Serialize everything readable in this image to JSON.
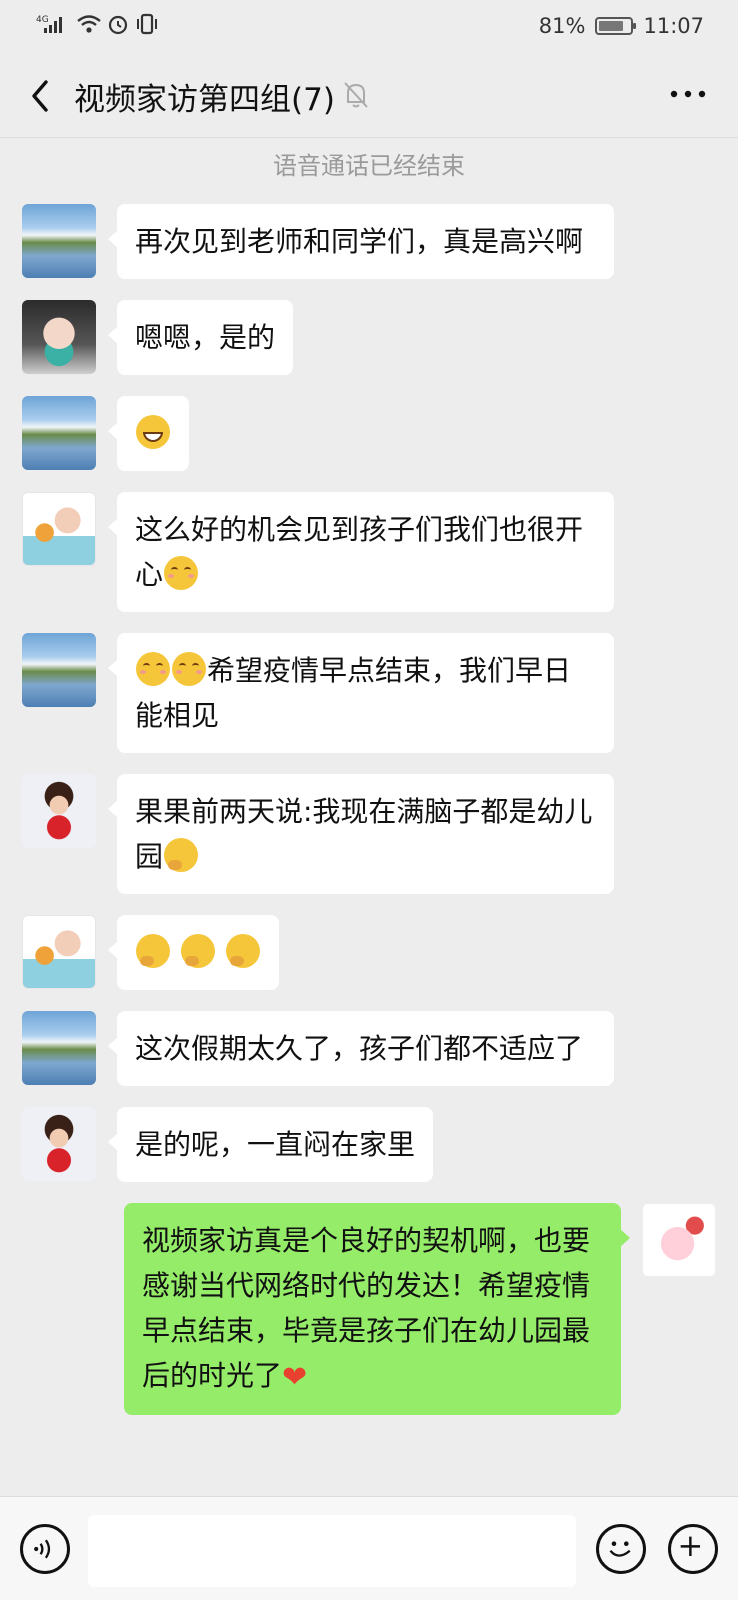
{
  "status_bar": {
    "network": "4G",
    "battery_percent": "81%",
    "battery_level": 0.81,
    "time": "11:07"
  },
  "header": {
    "title": "视频家访第四组(7)",
    "back_icon": "chevron-left-icon",
    "mute_icon": "bell-off-icon",
    "more_icon": "more-dots-icon"
  },
  "feed": {
    "system_notice": "语音通话已经结束",
    "messages": [
      {
        "side": "left",
        "avatar": "landscape",
        "text": "再次见到老师和同学们，真是高兴啊"
      },
      {
        "side": "left",
        "avatar": "girl-mask",
        "text": "嗯嗯，是的"
      },
      {
        "side": "left",
        "avatar": "landscape",
        "emoji": "grin"
      },
      {
        "side": "left",
        "avatar": "flower-girl",
        "text": "这么好的机会见到孩子们我们也很开心",
        "trailing_emoji": "smile"
      },
      {
        "side": "left",
        "avatar": "landscape",
        "leading_emoji": "smile smile",
        "text": "希望疫情早点结束，我们早日能相见"
      },
      {
        "side": "left",
        "avatar": "doll",
        "text": "果果前两天说:我现在满脑子都是幼儿园",
        "trailing_emoji": "think"
      },
      {
        "side": "left",
        "avatar": "flower-girl",
        "emoji": "think think think"
      },
      {
        "side": "left",
        "avatar": "landscape",
        "text": "这次假期太久了，孩子们都不适应了"
      },
      {
        "side": "left",
        "avatar": "doll",
        "text": "是的呢，一直闷在家里"
      },
      {
        "side": "right",
        "avatar": "pig",
        "text": "视频家访真是个良好的契机啊，也要感谢当代网络时代的发达！希望疫情早点结束，毕竟是孩子们在幼儿园最后的时光了",
        "trailing_emoji": "heart"
      }
    ]
  },
  "input_bar": {
    "voice_icon": "voice-icon",
    "emoji_icon": "emoji-face-icon",
    "add_icon": "plus-circle-icon",
    "text_value": ""
  },
  "colors": {
    "background": "#ededed",
    "bubble_left": "#ffffff",
    "bubble_self": "#95ec69"
  }
}
